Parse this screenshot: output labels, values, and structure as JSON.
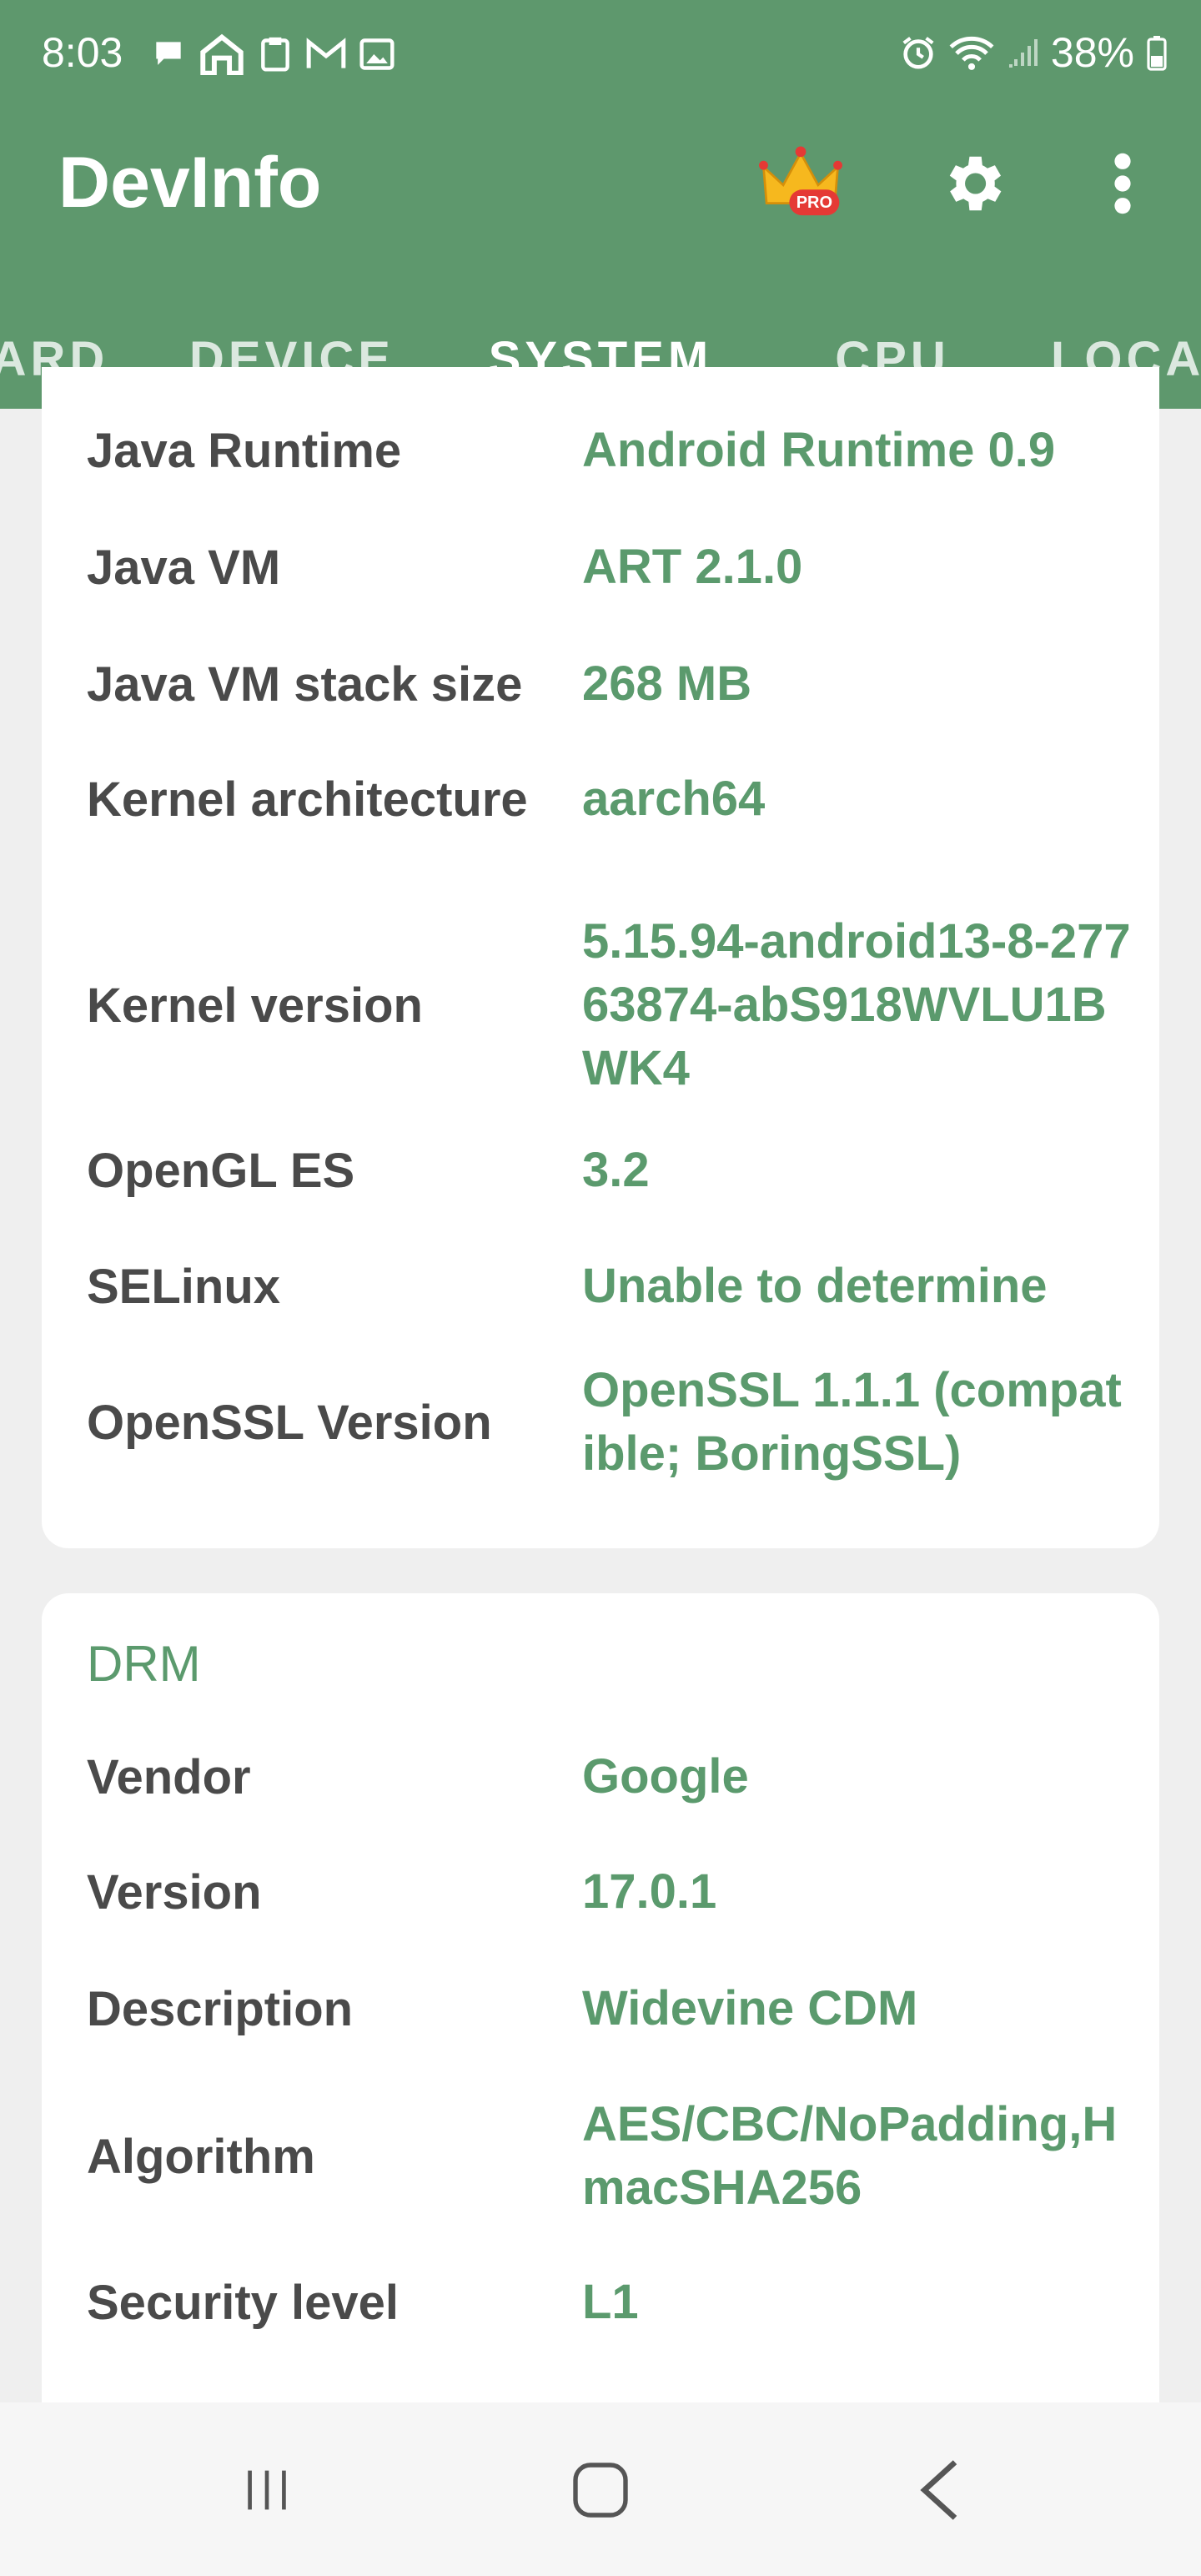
{
  "status_bar": {
    "time": "8:03",
    "battery": "38%",
    "notification_icons": [
      "chat-icon",
      "home-icon",
      "clipboard-icon",
      "gmail-icon",
      "image-icon"
    ],
    "system_icons": [
      "alarm-icon",
      "wifi-icon",
      "signal-icon",
      "battery-icon"
    ]
  },
  "app": {
    "title": "DevInfo",
    "badge": "PRO",
    "actions": [
      "pro-crown-icon",
      "settings-icon",
      "overflow-menu-icon"
    ]
  },
  "tabs": [
    {
      "label": "ARD",
      "active": false
    },
    {
      "label": "DEVICE",
      "active": false
    },
    {
      "label": "SYSTEM",
      "active": true
    },
    {
      "label": "CPU",
      "active": false
    },
    {
      "label": "LOCA",
      "active": false
    }
  ],
  "system_card": {
    "rows": [
      {
        "label": "Java Runtime",
        "value": "Android Runtime 0.9"
      },
      {
        "label": "Java VM",
        "value": "ART 2.1.0"
      },
      {
        "label": "Java VM stack size",
        "value": "268 MB"
      },
      {
        "label": "Kernel architecture",
        "value": "aarch64"
      },
      {
        "label": "Kernel version",
        "value": "5.15.94-android13-8-27763874-abS918WVLU1BWK4"
      },
      {
        "label": "OpenGL ES",
        "value": "3.2"
      },
      {
        "label": "SELinux",
        "value": "Unable to determine"
      },
      {
        "label": "OpenSSL Version",
        "value": "OpenSSL 1.1.1 (compatible; BoringSSL)"
      }
    ]
  },
  "drm_card": {
    "title": "DRM",
    "rows": [
      {
        "label": "Vendor",
        "value": "Google"
      },
      {
        "label": "Version",
        "value": "17.0.1"
      },
      {
        "label": "Description",
        "value": "Widevine CDM"
      },
      {
        "label": "Algorithm",
        "value": "AES/CBC/NoPadding,HmacSHA256"
      },
      {
        "label": "Security level",
        "value": "L1"
      }
    ]
  },
  "nav_bar": [
    "recents-icon",
    "home-icon",
    "back-icon"
  ],
  "colors": {
    "app_bar": "#5e986d",
    "accent": "#5b9a6d",
    "tab_indicator": "#a7d9b2",
    "background": "#efefef"
  }
}
